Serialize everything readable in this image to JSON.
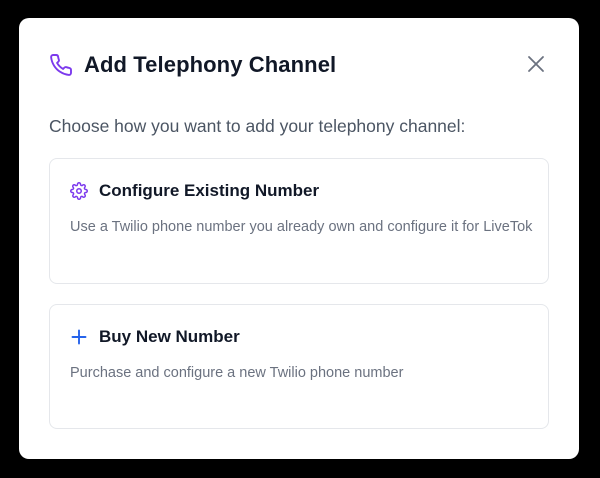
{
  "dialog": {
    "title": "Add Telephony Channel",
    "subtitle": "Choose how you want to add your telephony channel:",
    "icon": "phone-icon",
    "close_icon": "close-icon",
    "accent_color": "#7c3aed",
    "options": [
      {
        "icon": "gear-icon",
        "title": "Configure Existing Number",
        "description": "Use a Twilio phone number you already own and configure it for LiveTok",
        "icon_color": "#7c3aed"
      },
      {
        "icon": "plus-icon",
        "title": "Buy New Number",
        "description": "Purchase and configure a new Twilio phone number",
        "icon_color": "#2563eb"
      }
    ]
  }
}
